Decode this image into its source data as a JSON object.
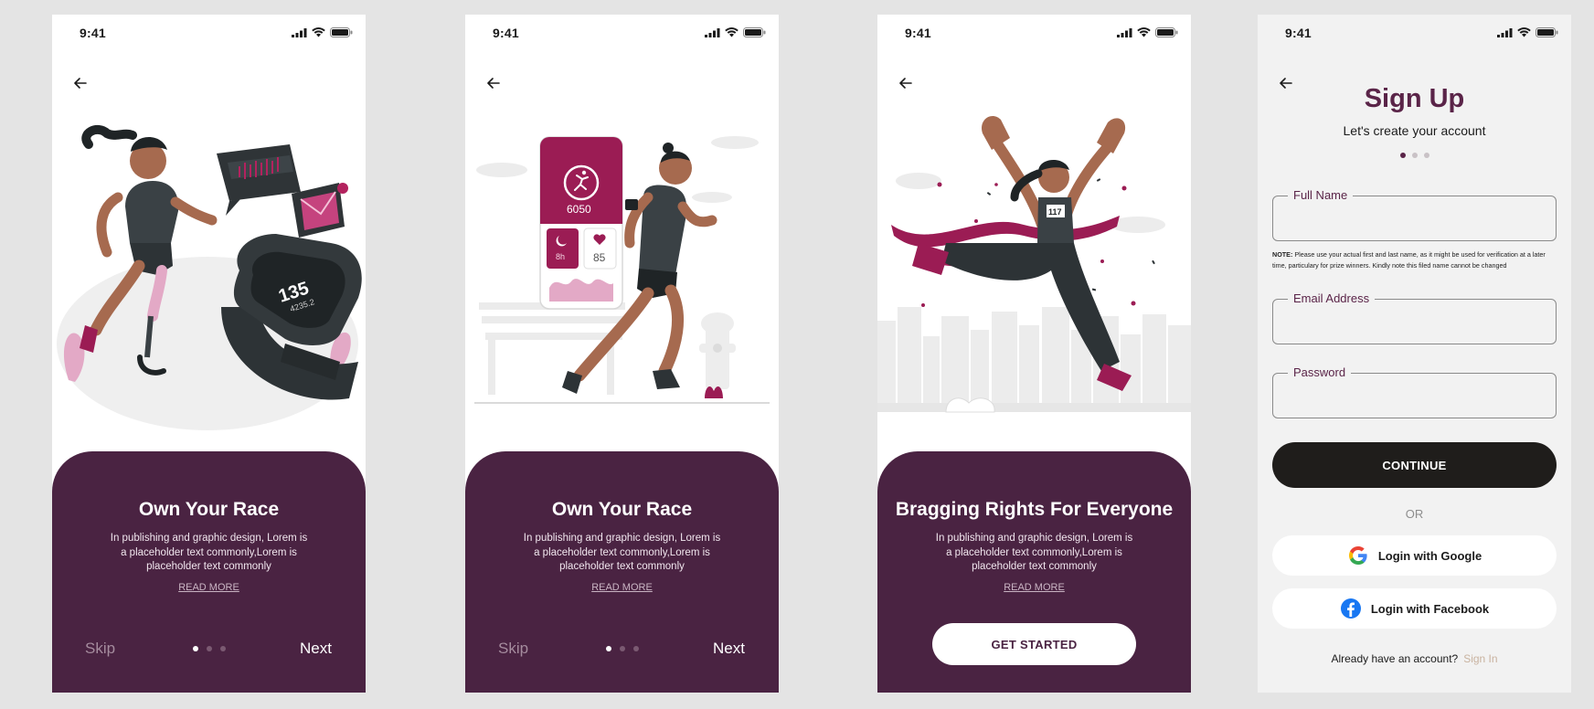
{
  "status": {
    "time": "9:41"
  },
  "screens": [
    {
      "title": "Own Your Race",
      "body": "In publishing and graphic design, Lorem is a placeholder text commonly,Lorem is placeholder text commonly",
      "read_more": "READ MORE",
      "skip": "Skip",
      "next": "Next",
      "active_dot": 1
    },
    {
      "title": "Own Your Race",
      "body": "In publishing and graphic design, Lorem is a placeholder text commonly,Lorem is placeholder text commonly",
      "read_more": "READ MORE",
      "skip": "Skip",
      "next": "Next",
      "active_dot": 1,
      "app_card": {
        "steps": "6050",
        "sleep": "8h",
        "heart": "85"
      }
    },
    {
      "title": "Bragging Rights For Everyone",
      "body": "In publishing and graphic design, Lorem is a placeholder text commonly,Lorem is placeholder text commonly",
      "read_more": "READ MORE",
      "cta": "GET STARTED",
      "bib": "117"
    }
  ],
  "watch": {
    "value": "135",
    "sub": "4235.2"
  },
  "signup": {
    "title": "Sign Up",
    "subtitle": "Let's create your account",
    "active_dot": 1,
    "full_name_label": "Full Name",
    "note_label": "NOTE:",
    "note_text": " Please use your actual first and last name, as it might be used for verification at a later time, particulary for prize winners. Kindly note this filed name cannot be changed",
    "email_label": "Email Address",
    "password_label": "Password",
    "continue": "CONTINUE",
    "or": "OR",
    "google": "Login with Google",
    "facebook": "Login with Facebook",
    "account_prompt": "Already have an account?",
    "sign_in": "Sign In"
  },
  "colors": {
    "plum": "#4a2342",
    "accent": "#9b1c54",
    "dark": "#1f1d1b",
    "background": "#e4e4e4"
  }
}
